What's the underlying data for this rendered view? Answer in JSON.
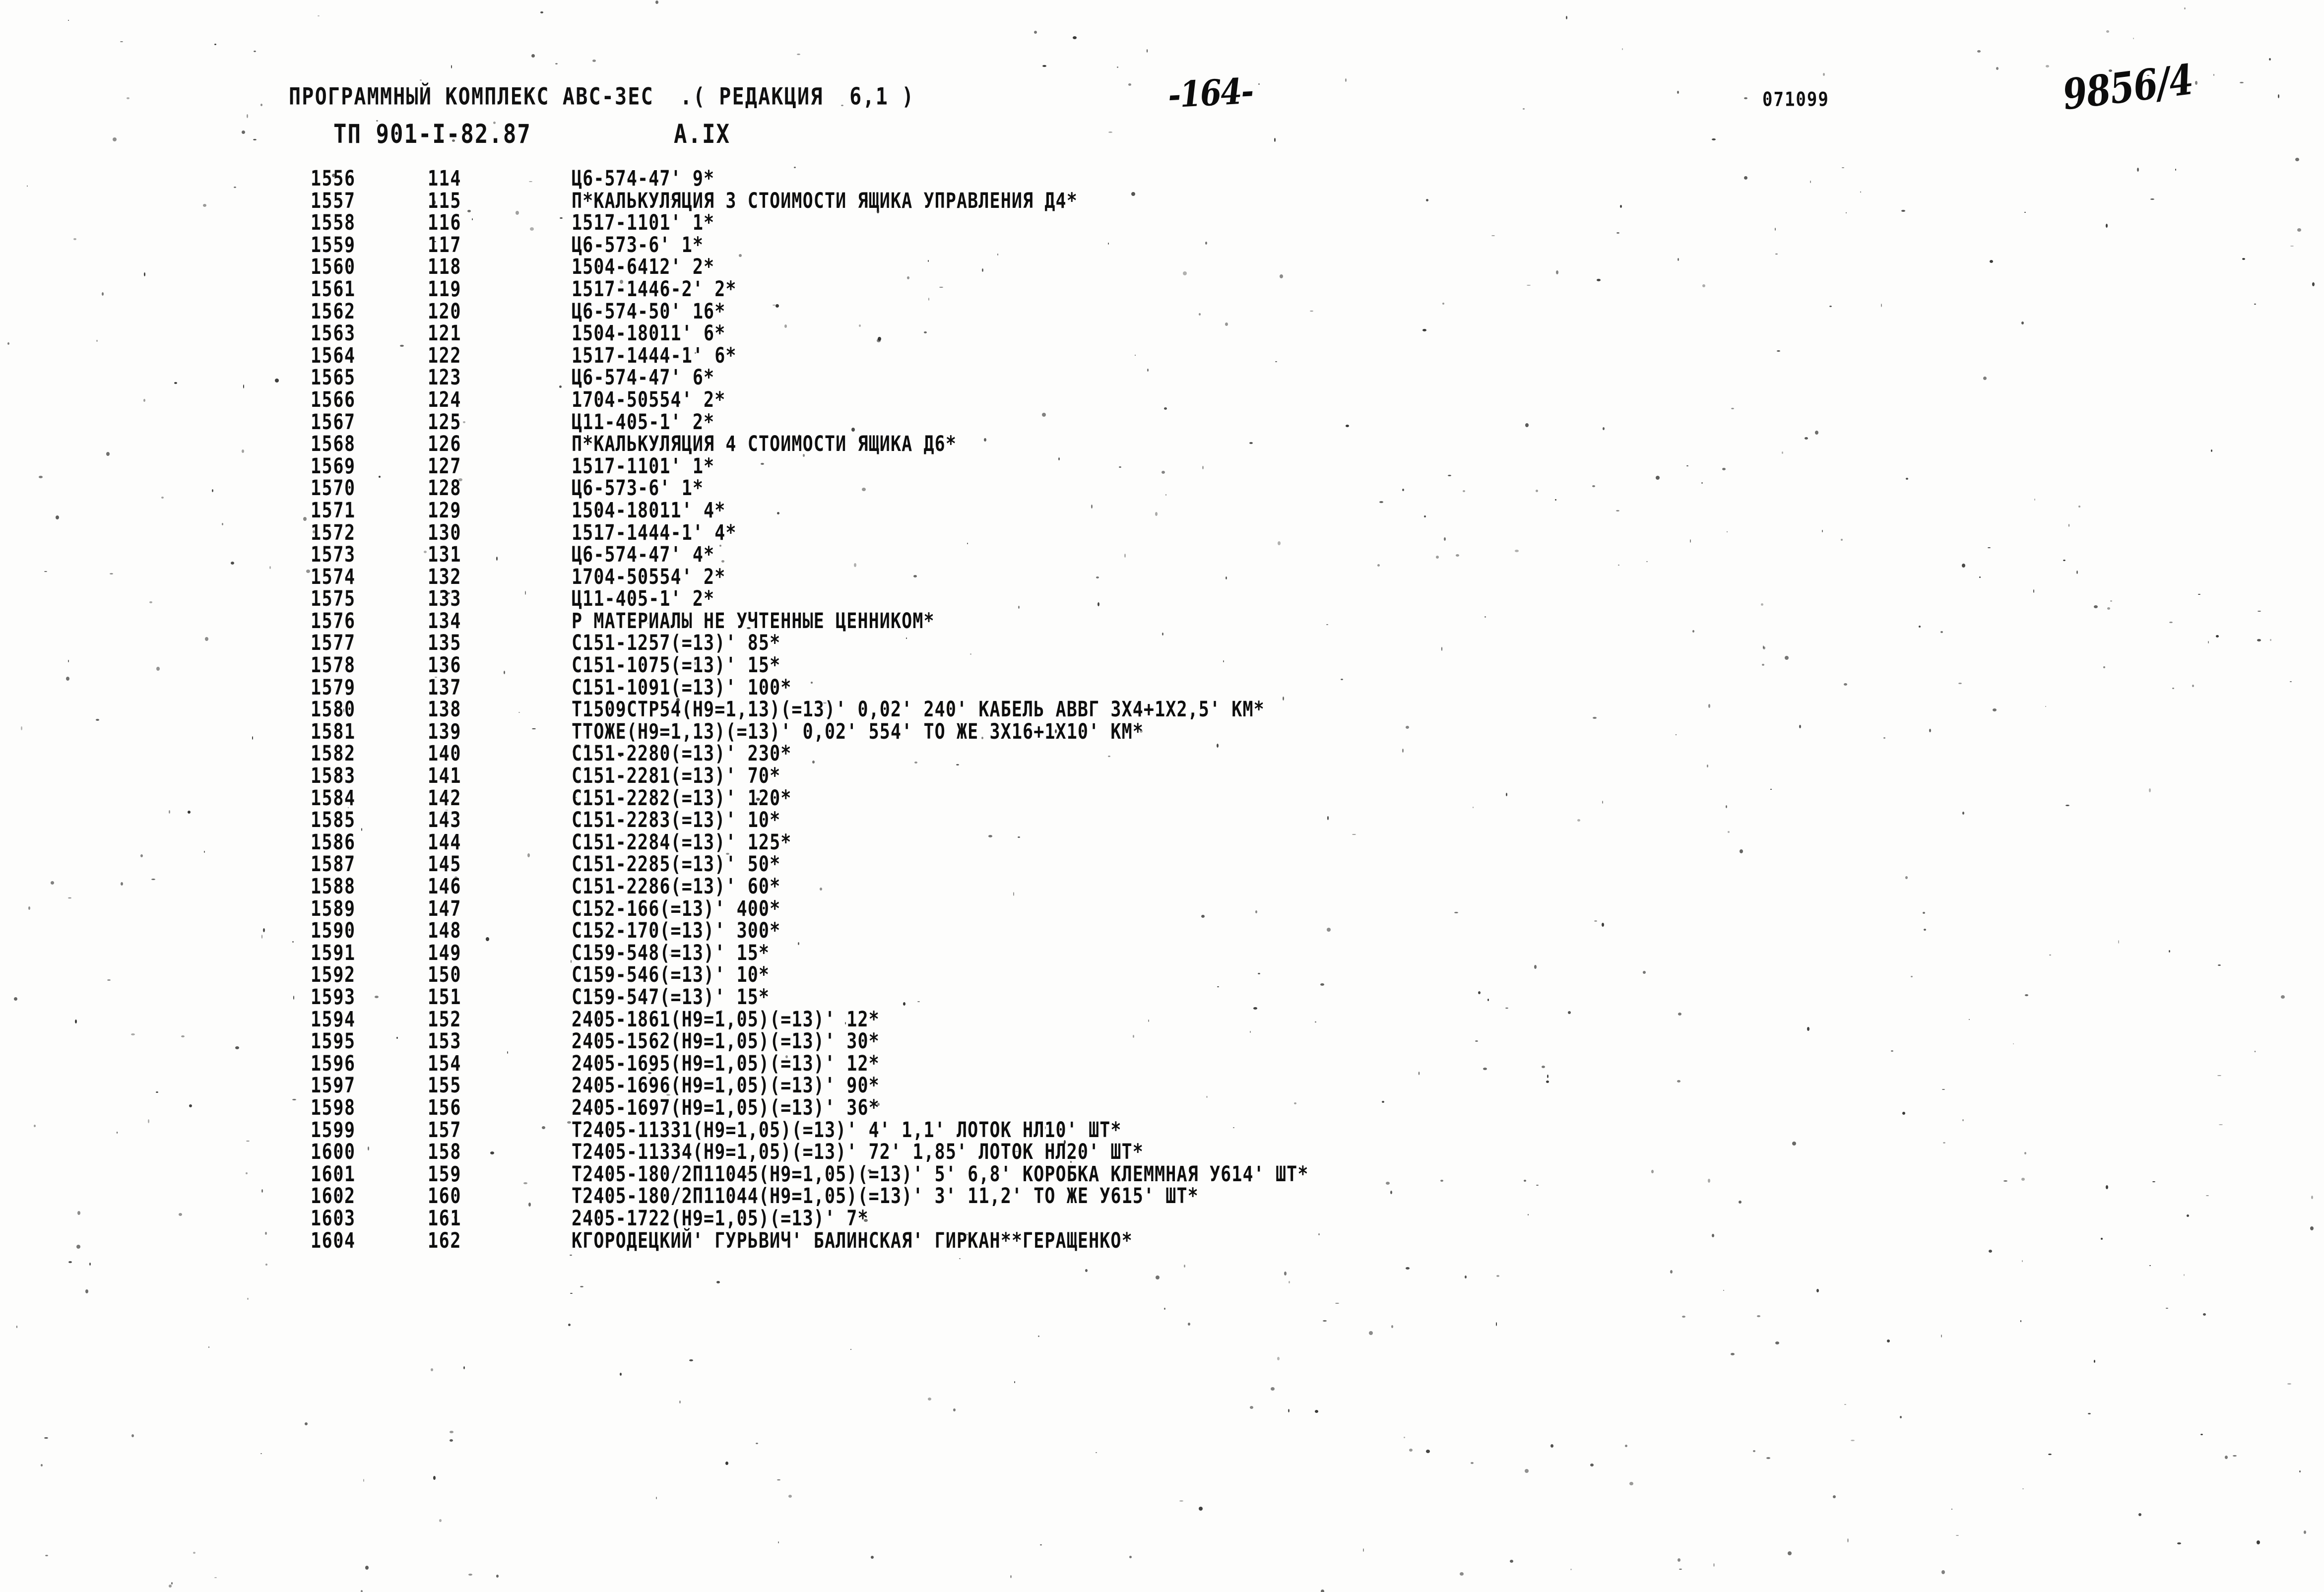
{
  "header": {
    "program_line": "ПРОГРАММНЫЙ КОМПЛЕКС АВС-ЗЕС  .( РЕДАКЦИЯ  6,1 )",
    "project_code": "ТП 901-I-82.87",
    "section_code": "А.IX",
    "printed_code": "071099",
    "page_number_handwritten": "-164-",
    "doc_number_handwritten": "9856/4"
  },
  "listing": {
    "columns": [
      "seq",
      "idx",
      "text"
    ],
    "rows": [
      {
        "seq": "1556",
        "idx": "114",
        "text": "Ц6-574-47' 9*"
      },
      {
        "seq": "1557",
        "idx": "115",
        "text": "П*КАЛЬКУЛЯЦИЯ 3 СТОИМОСТИ ЯЩИКА УПРАВЛЕНИЯ Д4*"
      },
      {
        "seq": "1558",
        "idx": "116",
        "text": "1517-1101' 1*"
      },
      {
        "seq": "1559",
        "idx": "117",
        "text": "Ц6-573-6' 1*"
      },
      {
        "seq": "1560",
        "idx": "118",
        "text": "1504-6412' 2*"
      },
      {
        "seq": "1561",
        "idx": "119",
        "text": "1517-1446-2' 2*"
      },
      {
        "seq": "1562",
        "idx": "120",
        "text": "Ц6-574-50' 16*"
      },
      {
        "seq": "1563",
        "idx": "121",
        "text": "1504-18011' 6*"
      },
      {
        "seq": "1564",
        "idx": "122",
        "text": "1517-1444-1' 6*"
      },
      {
        "seq": "1565",
        "idx": "123",
        "text": "Ц6-574-47' 6*"
      },
      {
        "seq": "1566",
        "idx": "124",
        "text": "1704-50554' 2*"
      },
      {
        "seq": "1567",
        "idx": "125",
        "text": "Ц11-405-1' 2*"
      },
      {
        "seq": "1568",
        "idx": "126",
        "text": "П*КАЛЬКУЛЯЦИЯ 4 СТОИМОСТИ ЯЩИКА Д6*"
      },
      {
        "seq": "1569",
        "idx": "127",
        "text": "1517-1101' 1*"
      },
      {
        "seq": "1570",
        "idx": "128",
        "text": "Ц6-573-6' 1*"
      },
      {
        "seq": "1571",
        "idx": "129",
        "text": "1504-18011' 4*"
      },
      {
        "seq": "1572",
        "idx": "130",
        "text": "1517-1444-1' 4*"
      },
      {
        "seq": "1573",
        "idx": "131",
        "text": "Ц6-574-47' 4*"
      },
      {
        "seq": "1574",
        "idx": "132",
        "text": "1704-50554' 2*"
      },
      {
        "seq": "1575",
        "idx": "133",
        "text": "Ц11-405-1' 2*"
      },
      {
        "seq": "1576",
        "idx": "134",
        "text": "Р МАТЕРИАЛЫ НЕ УЧТЕННЫЕ ЦЕННИКОМ*"
      },
      {
        "seq": "1577",
        "idx": "135",
        "text": "С151-1257(=13)' 85*"
      },
      {
        "seq": "1578",
        "idx": "136",
        "text": "С151-1075(=13)' 15*"
      },
      {
        "seq": "1579",
        "idx": "137",
        "text": "С151-1091(=13)' 100*"
      },
      {
        "seq": "1580",
        "idx": "138",
        "text": "Т1509СТР54(Н9=1,13)(=13)' 0,02' 240' КАБЕЛЬ АВВГ 3Х4+1Х2,5' КМ*"
      },
      {
        "seq": "1581",
        "idx": "139",
        "text": "ТТОЖЕ(Н9=1,13)(=13)' 0,02' 554' ТО ЖЕ 3Х16+1Х10' КМ*"
      },
      {
        "seq": "1582",
        "idx": "140",
        "text": "С151-2280(=13)' 230*"
      },
      {
        "seq": "1583",
        "idx": "141",
        "text": "С151-2281(=13)' 70*"
      },
      {
        "seq": "1584",
        "idx": "142",
        "text": "С151-2282(=13)' 120*"
      },
      {
        "seq": "1585",
        "idx": "143",
        "text": "С151-2283(=13)' 10*"
      },
      {
        "seq": "1586",
        "idx": "144",
        "text": "С151-2284(=13)' 125*"
      },
      {
        "seq": "1587",
        "idx": "145",
        "text": "С151-2285(=13)' 50*"
      },
      {
        "seq": "1588",
        "idx": "146",
        "text": "С151-2286(=13)' 60*"
      },
      {
        "seq": "1589",
        "idx": "147",
        "text": "С152-166(=13)' 400*"
      },
      {
        "seq": "1590",
        "idx": "148",
        "text": "С152-170(=13)' 300*"
      },
      {
        "seq": "1591",
        "idx": "149",
        "text": "С159-548(=13)' 15*"
      },
      {
        "seq": "1592",
        "idx": "150",
        "text": "С159-546(=13)' 10*"
      },
      {
        "seq": "1593",
        "idx": "151",
        "text": "С159-547(=13)' 15*"
      },
      {
        "seq": "1594",
        "idx": "152",
        "text": "2405-1861(Н9=1,05)(=13)' 12*"
      },
      {
        "seq": "1595",
        "idx": "153",
        "text": "2405-1562(Н9=1,05)(=13)' 30*"
      },
      {
        "seq": "1596",
        "idx": "154",
        "text": "2405-1695(Н9=1,05)(=13)' 12*"
      },
      {
        "seq": "1597",
        "idx": "155",
        "text": "2405-1696(Н9=1,05)(=13)' 90*"
      },
      {
        "seq": "1598",
        "idx": "156",
        "text": "2405-1697(Н9=1,05)(=13)' 36*"
      },
      {
        "seq": "1599",
        "idx": "157",
        "text": "Т2405-11331(Н9=1,05)(=13)' 4' 1,1' ЛОТОК НЛ10' ШТ*"
      },
      {
        "seq": "1600",
        "idx": "158",
        "text": "Т2405-11334(Н9=1,05)(=13)' 72' 1,85' ЛОТОК НЛ20' ШТ*"
      },
      {
        "seq": "1601",
        "idx": "159",
        "text": "Т2405-180/2П11045(Н9=1,05)(=13)' 5' 6,8' КОРОБКА КЛЕММНАЯ У614' ШТ*"
      },
      {
        "seq": "1602",
        "idx": "160",
        "text": "Т2405-180/2П11044(Н9=1,05)(=13)' 3' 11,2' ТО ЖЕ У615' ШТ*"
      },
      {
        "seq": "1603",
        "idx": "161",
        "text": "2405-1722(Н9=1,05)(=13)' 7*"
      },
      {
        "seq": "1604",
        "idx": "162",
        "text": "КГОРОДЕЦКИЙ' ГУРЬВИЧ' БАЛИНСКАЯ' ГИРКАН**ГЕРАЩЕНКО*"
      }
    ]
  }
}
